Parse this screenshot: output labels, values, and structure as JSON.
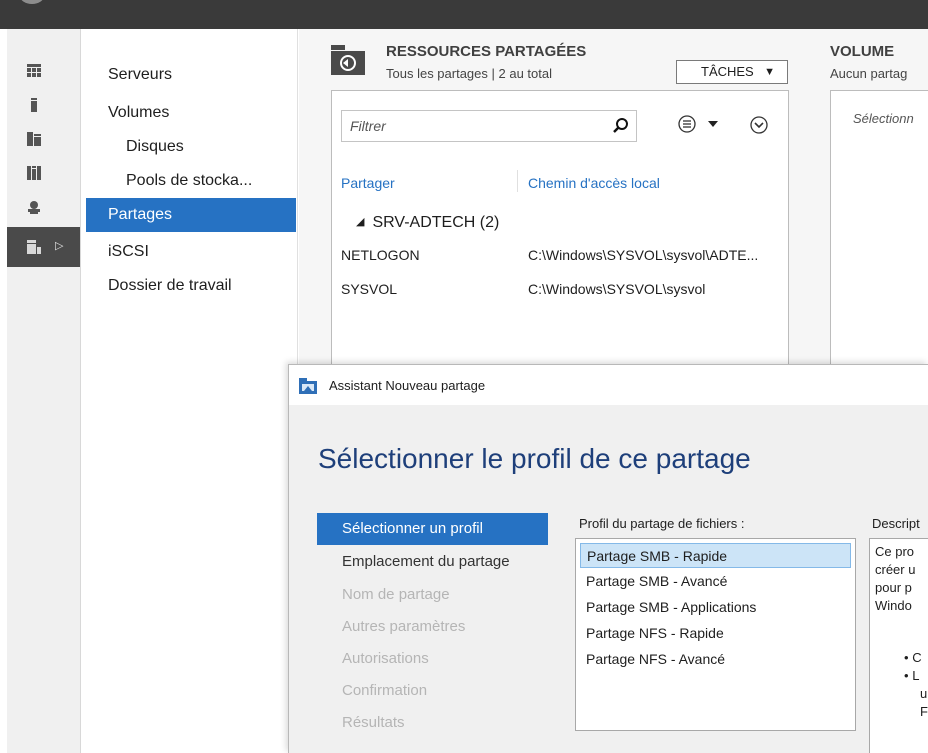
{
  "rail": {
    "icons": [
      "dashboard-icon",
      "local-server-icon",
      "all-servers-icon",
      "file-storage-icon",
      "iis-icon",
      "file-services-icon"
    ]
  },
  "nav": {
    "items": [
      {
        "label": "Serveurs"
      },
      {
        "label": "Volumes"
      },
      {
        "label": "Disques"
      },
      {
        "label": "Pools de stocka..."
      },
      {
        "label": "Partages"
      },
      {
        "label": "iSCSI"
      },
      {
        "label": "Dossier de travail"
      }
    ]
  },
  "resources": {
    "title": "RESSOURCES PARTAGÉES",
    "subtitle": "Tous les partages | 2 au total",
    "tasks_label": "TÂCHES",
    "filter_placeholder": "Filtrer",
    "columns": [
      "Partager",
      "Chemin d'accès local"
    ],
    "group": "SRV-ADTECH (2)",
    "rows": [
      {
        "name": "NETLOGON",
        "path": "C:\\Windows\\SYSVOL\\sysvol\\ADTE..."
      },
      {
        "name": "SYSVOL",
        "path": "C:\\Windows\\SYSVOL\\sysvol"
      }
    ]
  },
  "volume": {
    "title": "VOLUME",
    "subtitle": "Aucun partag",
    "placeholder": "Sélectionn"
  },
  "wizard": {
    "title": "Assistant Nouveau partage",
    "heading": "Sélectionner le profil de ce partage",
    "steps": [
      {
        "label": "Sélectionner un profil"
      },
      {
        "label": "Emplacement du partage"
      },
      {
        "label": "Nom de partage"
      },
      {
        "label": "Autres paramètres"
      },
      {
        "label": "Autorisations"
      },
      {
        "label": "Confirmation"
      },
      {
        "label": "Résultats"
      }
    ],
    "profile_label": "Profil du partage de fichiers :",
    "profiles": [
      {
        "label": "Partage SMB - Rapide"
      },
      {
        "label": "Partage SMB - Avancé"
      },
      {
        "label": "Partage SMB - Applications"
      },
      {
        "label": "Partage NFS - Rapide"
      },
      {
        "label": "Partage NFS - Avancé"
      }
    ],
    "description_label": "Descript",
    "description_lines": [
      "Ce pro",
      "créer u",
      "pour p",
      "Windo"
    ],
    "bullets": [
      {
        "bullet": "•",
        "text": "C"
      },
      {
        "bullet": "•",
        "text": "L"
      }
    ],
    "bullet_cont": [
      "u",
      "F"
    ]
  },
  "colors": {
    "accent": "#2672c3",
    "selection": "#cce4f7",
    "heading": "#1e3f7a",
    "topbar": "#3a3a3a"
  }
}
